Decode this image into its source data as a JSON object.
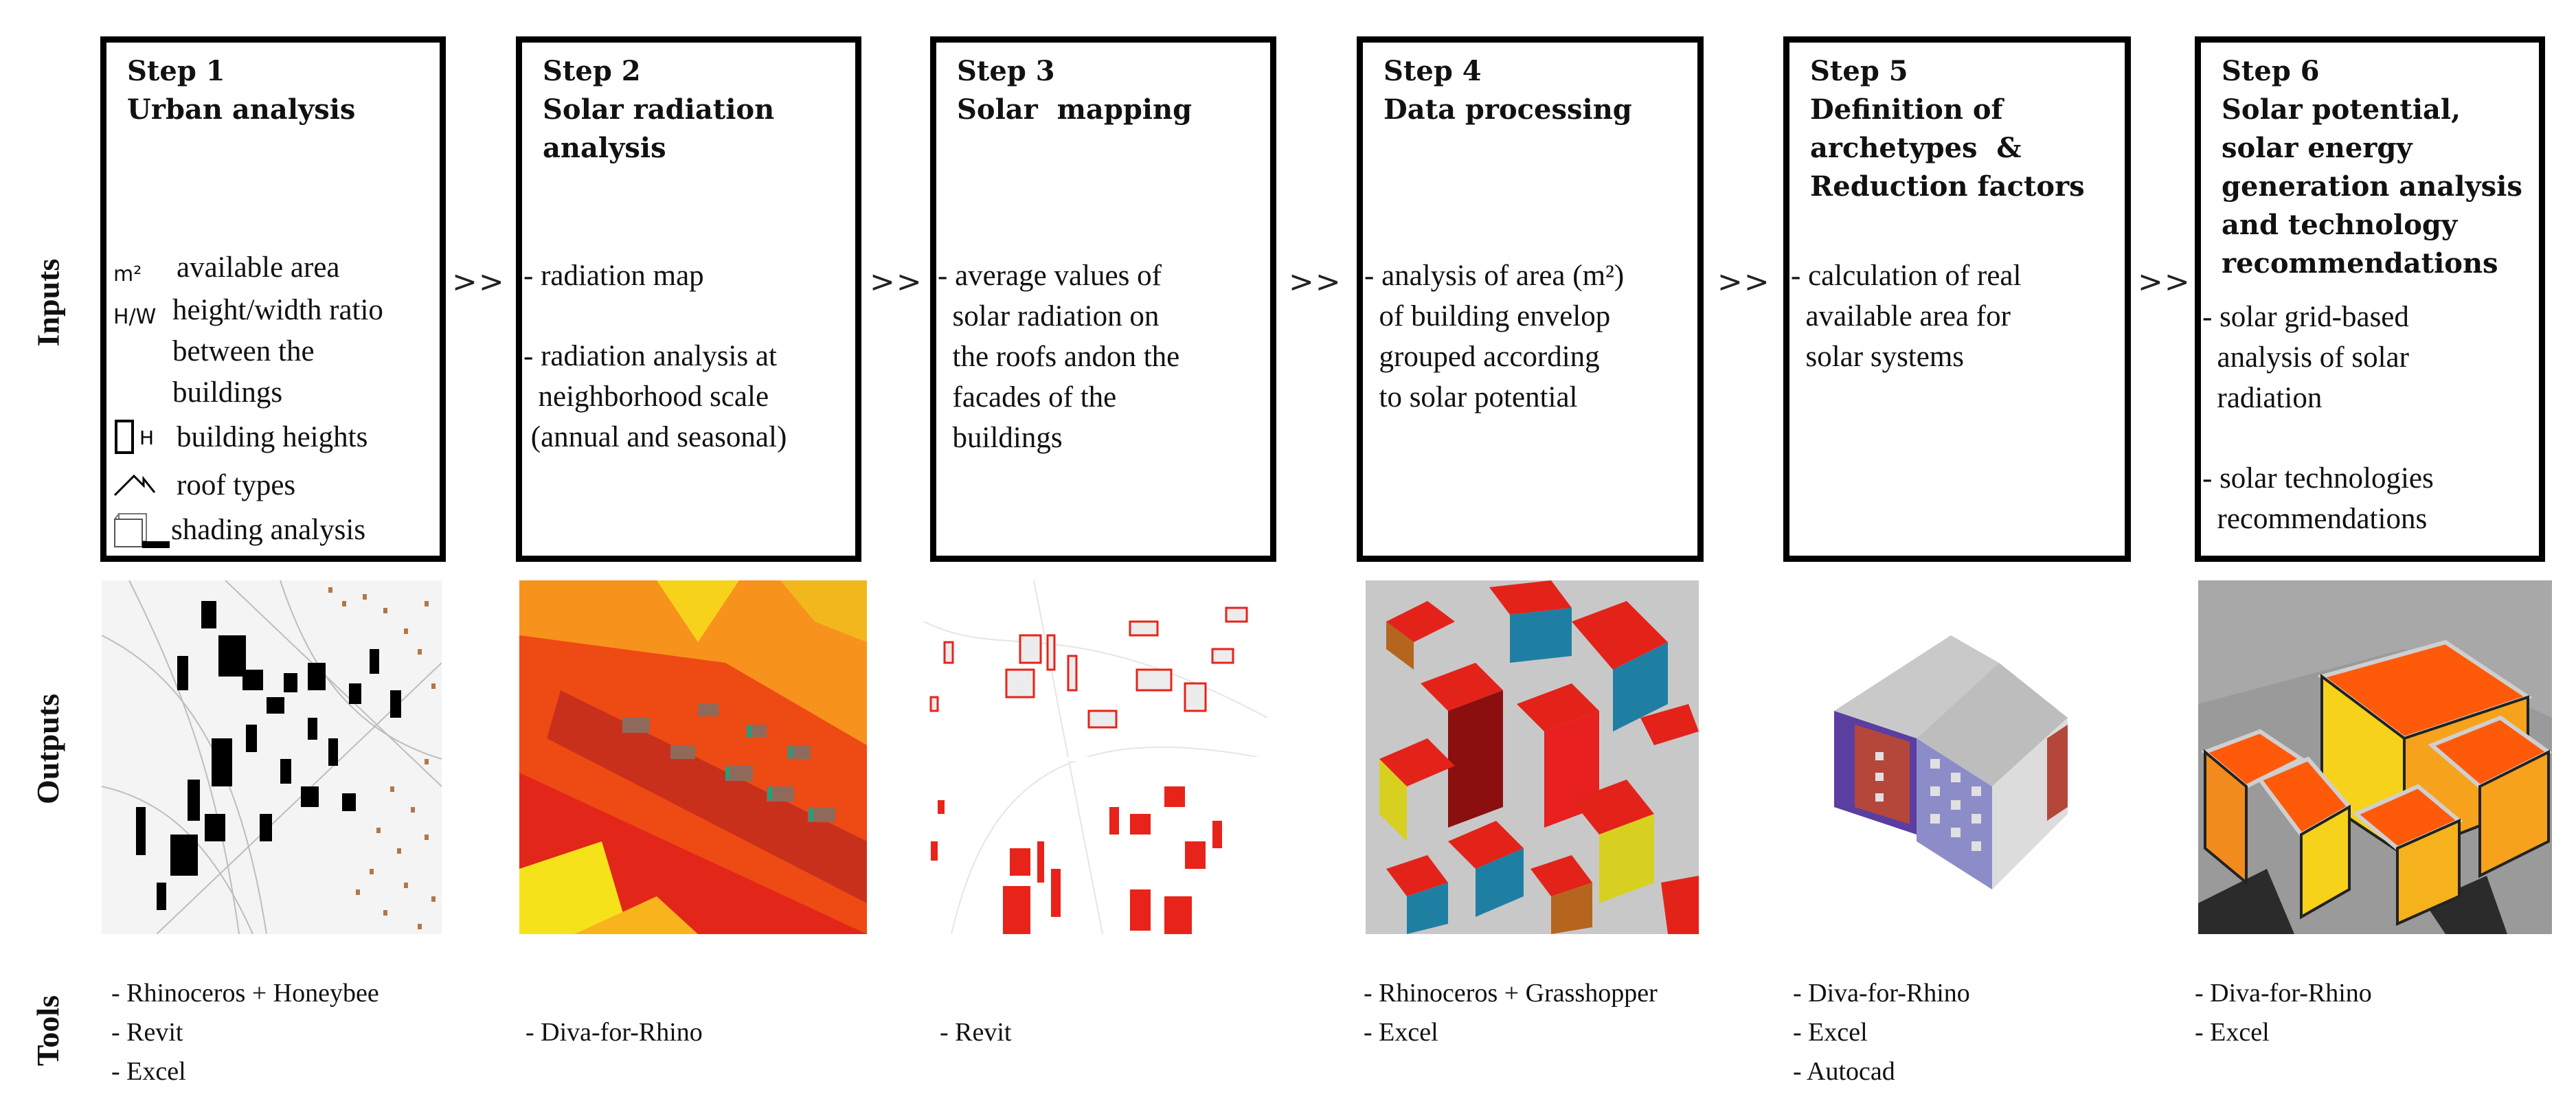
{
  "row_labels": {
    "inputs": "Inputs",
    "outputs": "Outputs",
    "tools": "Tools"
  },
  "arrow_symbol": ">>",
  "steps": [
    {
      "step": "Step 1",
      "title_lines": [
        "Urban analysis"
      ],
      "legend": [
        {
          "icon": "m2-area-icon",
          "symbol": "m²",
          "lines": [
            "available area"
          ]
        },
        {
          "icon": "height-width-ratio-icon",
          "symbol": "H/W",
          "lines": [
            "height/width ratio",
            "between the",
            "buildings"
          ]
        },
        {
          "icon": "building-height-icon",
          "symbol": "H",
          "lines": [
            "building heights"
          ]
        },
        {
          "icon": "roof-icon",
          "symbol": "",
          "lines": [
            "roof types"
          ]
        },
        {
          "icon": "shading-box-icon",
          "symbol": "",
          "lines": [
            "shading analysis"
          ]
        }
      ],
      "output_image": "urban-site-plan-image",
      "tools": [
        "- Rhinoceros + Honeybee",
        "- Revit",
        "- Excel"
      ]
    },
    {
      "step": "Step 2",
      "title_lines": [
        "Solar radiation",
        "analysis"
      ],
      "inputs": [
        [
          "- radiation map"
        ],
        [
          "- radiation analysis at",
          "  neighborhood scale",
          " (annual and seasonal)"
        ]
      ],
      "output_image": "radiation-map-image",
      "tools": [
        "- Diva-for-Rhino"
      ]
    },
    {
      "step": "Step 3",
      "title_lines": [
        "Solar  mapping"
      ],
      "inputs": [
        [
          "- average values of",
          "  solar radiation on",
          "  the roofs andon the",
          "  facades of the",
          "  buildings"
        ]
      ],
      "output_image": "solar-mapping-image",
      "tools": [
        "- Revit"
      ]
    },
    {
      "step": "Step 4",
      "title_lines": [
        "Data processing"
      ],
      "inputs": [
        [
          "- analysis of area (m²)",
          "  of building envelop",
          "  grouped according",
          "  to solar potential"
        ]
      ],
      "output_image": "envelope-3d-model-image",
      "tools": [
        "- Rhinoceros + Grasshopper",
        "- Excel"
      ]
    },
    {
      "step": "Step 5",
      "title_lines": [
        "Definition of",
        "archetypes  &",
        "Reduction factors"
      ],
      "inputs": [
        [
          "- calculation of real",
          "  available area for",
          "  solar systems"
        ]
      ],
      "output_image": "building-archetype-image",
      "tools": [
        "- Diva-for-Rhino",
        "- Excel",
        "- Autocad"
      ]
    },
    {
      "step": "Step 6",
      "title_lines": [
        "Solar potential,",
        "solar energy",
        "generation analysis",
        "and technology",
        "recommendations"
      ],
      "inputs": [
        [
          "- solar grid-based",
          "  analysis of solar",
          "  radiation"
        ],
        [
          "- solar technologies",
          "  recommendations"
        ]
      ],
      "output_image": "solar-potential-3d-image",
      "tools": [
        "- Diva-for-Rhino",
        "- Excel"
      ]
    }
  ],
  "colors": {
    "box_border": "#000000",
    "radiation_red": "#e8231a",
    "radiation_orange": "#f77a12",
    "radiation_yellow": "#f6e21b",
    "facade_blue": "#1f7fa3",
    "roof_gray": "#c8c8c8",
    "archetype_purple": "#5a3ea0"
  }
}
